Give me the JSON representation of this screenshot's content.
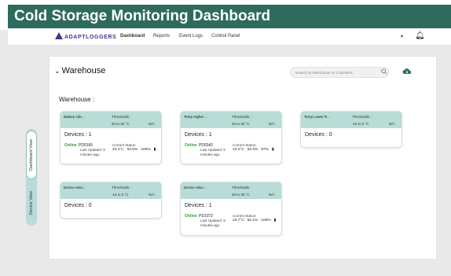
{
  "banner": {
    "title": "Cold Storage Monitoring Dashboard"
  },
  "nav": {
    "logo_text": "ADAPTLOGGERS",
    "links": [
      "Dashboard",
      "Reports",
      "Event Logs",
      "Control Panel"
    ],
    "active": "Dashboard"
  },
  "sidebar": {
    "tabs": [
      "Dashboard View",
      "Device View"
    ],
    "active": "Dashboard View"
  },
  "warehouse": {
    "header": "Warehouse",
    "label": "Warehouse :",
    "search_placeholder": "Search by Warehouse Or Chambers"
  },
  "cards": [
    {
      "name": "Battery Life...",
      "thresholds_label": "Thresholds :",
      "thresholds_value": "20 to 35 °C",
      "na": "N/A",
      "devices": "Devices : 1",
      "device": {
        "status": "Online",
        "id": "PD0166",
        "last_updated": "Last Updated: 9 minutes ago",
        "current_label": "Current Status:",
        "temp": "23.4°C",
        "humidity": "62.6%",
        "battery": "100%"
      }
    },
    {
      "name": "Temp Higher ...",
      "thresholds_label": "Thresholds :",
      "thresholds_value": "20 to 35 °C",
      "na": "N/A",
      "devices": "Devices : 1",
      "device": {
        "status": "Online",
        "id": "PD0342",
        "last_updated": "Last Updated: 9 minutes ago",
        "current_label": "Current Status:",
        "temp": "23.4°C",
        "humidity": "62.2%",
        "battery": "97%"
      }
    },
    {
      "name": "Temp Lower R...",
      "thresholds_label": "Thresholds :",
      "thresholds_value": "-15 to 0 °C",
      "na": "N/A",
      "devices": "Devices : 0"
    },
    {
      "name": "Device reloc...",
      "thresholds_label": "Thresholds :",
      "thresholds_value": "-15 to 0 °C",
      "na": "N/A",
      "devices": "Devices : 0"
    },
    {
      "name": "Device reloc...",
      "thresholds_label": "Thresholds :",
      "thresholds_value": "20 to 35 °C",
      "na": "N/A",
      "devices": "Devices : 1",
      "device": {
        "status": "Online",
        "id": "PD1072",
        "last_updated": "Last Updated: 9 minutes ago",
        "current_label": "Current Status:",
        "temp": "23.7°C",
        "humidity": "62.1%",
        "battery": "100%"
      }
    }
  ],
  "colors": {
    "banner": "#2e6b5c",
    "card_header": "#b8dcd6",
    "online": "#3a9a3a",
    "logo": "#3a3a8a"
  }
}
